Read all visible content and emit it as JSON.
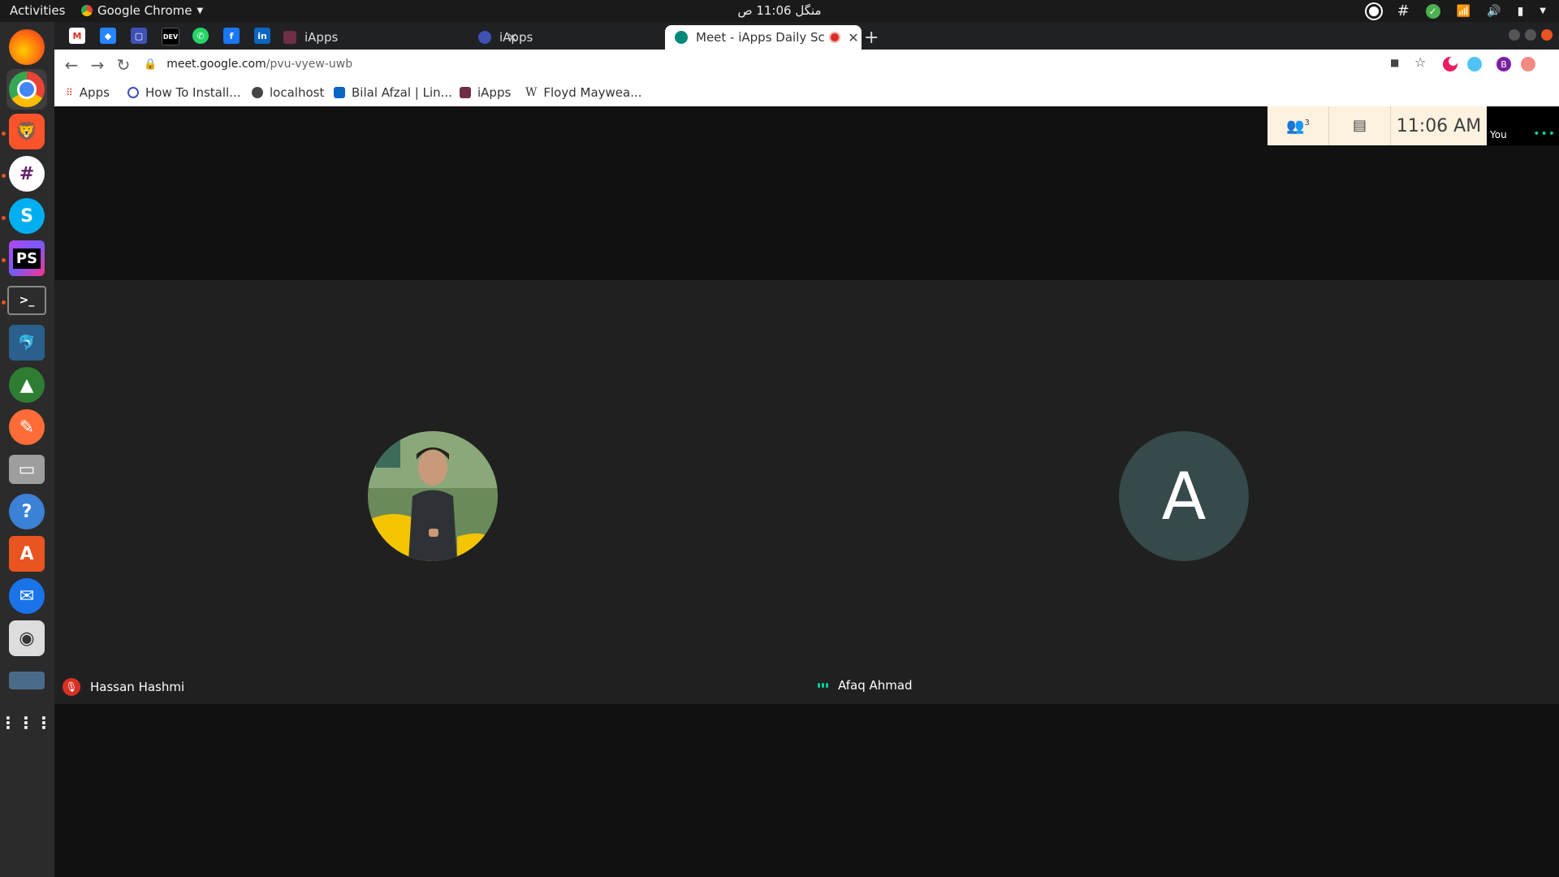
{
  "topbar": {
    "activities": "Activities",
    "app_name": "Google Chrome",
    "clock": "منگل 11:06 ص"
  },
  "dock": {
    "items": [
      "firefox-icon",
      "chrome-icon",
      "brave-icon",
      "slack-icon",
      "skype-icon",
      "phpstorm-icon",
      "terminal-icon",
      "mysql-workbench-icon",
      "robo3t-icon",
      "postman-icon",
      "archive-manager-icon",
      "help-icon",
      "software-center-icon",
      "thunderbird-icon",
      "rhythmbox-icon",
      "drive-icon",
      "show-apps-icon"
    ]
  },
  "chrome": {
    "tabs": [
      {
        "title": "iApps"
      },
      {
        "title": "iApps"
      },
      {
        "title": "Meet - iApps Daily Scru",
        "active": true
      }
    ],
    "pinned_tabs": [
      "gmail-icon",
      "jira-icon",
      "tab-icon",
      "dev-icon",
      "whatsapp-icon",
      "facebook-icon",
      "linkedin-icon"
    ],
    "pinned_dev_label": "DEV",
    "url_host": "meet.google.com",
    "url_path": "/pvu-vyew-uwb",
    "profile_initial": "B",
    "bookmarks": [
      {
        "label": "Apps"
      },
      {
        "label": "How To Install..."
      },
      {
        "label": "localhost"
      },
      {
        "label": "Bilal Afzal | Lin..."
      },
      {
        "label": "iApps"
      },
      {
        "label": "Floyd Maywea..."
      }
    ]
  },
  "meet": {
    "participant_count": "3",
    "time": "11:06 AM",
    "self_label": "You",
    "participants": [
      {
        "name": "Hassan Hashmi",
        "muted": true
      },
      {
        "name": "Afaq Ahmad",
        "initial": "A",
        "speaking": true
      }
    ]
  },
  "colors": {
    "accent_orange": "#e95420",
    "meet_green": "#00d09a",
    "mute_red": "#d93025",
    "info_bar": "#fdf1df"
  }
}
